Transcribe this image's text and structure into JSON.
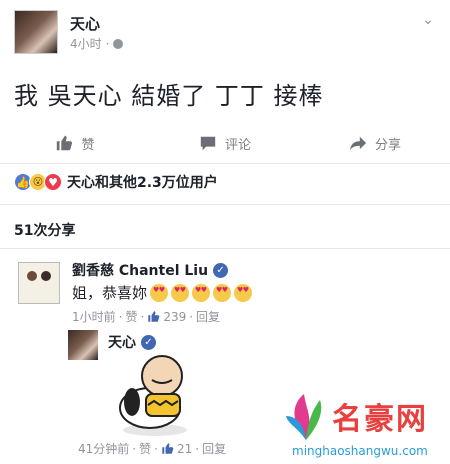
{
  "post": {
    "author": "天心",
    "time": "4小时",
    "separator": "·",
    "text": "我 吳天心 結婚了 丁丁 接棒"
  },
  "actions": {
    "like": "赞",
    "comment": "评论",
    "share": "分享"
  },
  "reactions": {
    "icons": [
      "like-icon",
      "wow-icon",
      "love-icon"
    ],
    "summary": "天心和其他2.3万位用户"
  },
  "shares": {
    "count_label": "51次分享"
  },
  "comment": {
    "author": "劉香慈 Chantel Liu",
    "text": "姐，恭喜妳",
    "emoji_count": 5,
    "time": "1小时前",
    "like_label": "赞",
    "like_count": "239",
    "reply_label": "回复",
    "dot": "·"
  },
  "reply": {
    "author": "天心",
    "time": "41分钟前",
    "like_label": "赞",
    "like_count": "21",
    "reply_label": "回复",
    "dot": "·"
  },
  "watermark": {
    "title": "名豪网",
    "url": "minghaoshangwu.com"
  },
  "colors": {
    "accent": "#4267b2",
    "meta_gray": "#90949c",
    "love": "#f0394b",
    "watermark_red": "#e8403e",
    "watermark_blue": "#2a9bd8"
  }
}
